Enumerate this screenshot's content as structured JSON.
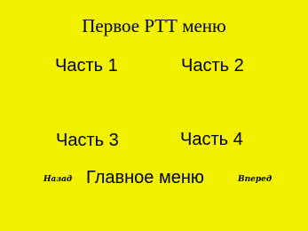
{
  "screen": {
    "title": "Первое РТТ меню",
    "background_color": "#f2f200"
  },
  "parts": [
    {
      "label": "Часть 1"
    },
    {
      "label": "Часть 2"
    },
    {
      "label": "Часть 3"
    },
    {
      "label": "Часть 4"
    }
  ],
  "nav": {
    "back_label": "Назад",
    "main_menu_label": "Главное меню",
    "forward_label": "Вперед"
  }
}
